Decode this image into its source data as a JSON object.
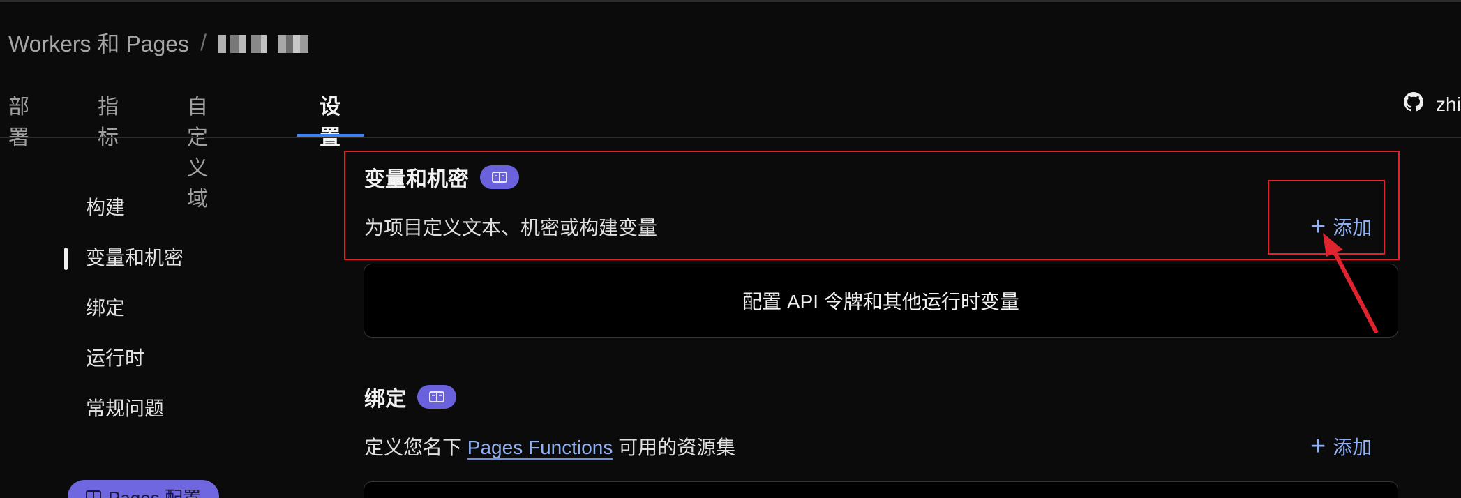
{
  "breadcrumb": {
    "root": "Workers 和 Pages",
    "separator": "/",
    "project": "ca·g·ra·rb"
  },
  "tabs": [
    {
      "label": "部署"
    },
    {
      "label": "指标"
    },
    {
      "label": "自定义域"
    },
    {
      "label": "设置",
      "active": true
    }
  ],
  "github": {
    "icon": "github-icon",
    "label": "zhi"
  },
  "sidenav": {
    "items": [
      {
        "label": "构建"
      },
      {
        "label": "变量和机密",
        "active": true
      },
      {
        "label": "绑定"
      },
      {
        "label": "运行时"
      },
      {
        "label": "常规问题"
      }
    ],
    "pages_config_label": "Pages 配置"
  },
  "variables": {
    "title": "变量和机密",
    "description": "为项目定义文本、机密或构建变量",
    "add_label": "添加",
    "empty_text": "配置 API 令牌和其他运行时变量"
  },
  "bindings": {
    "title": "绑定",
    "description_before": "定义您名下",
    "description_link": "Pages Functions",
    "description_after": "可用的资源集",
    "add_label": "添加"
  },
  "colors": {
    "background": "#0b0b0b",
    "accent_blue": "#3b82f6",
    "link": "#8fb0f5",
    "doc_pill": "#6962dc",
    "annotation": "#e0242f"
  }
}
